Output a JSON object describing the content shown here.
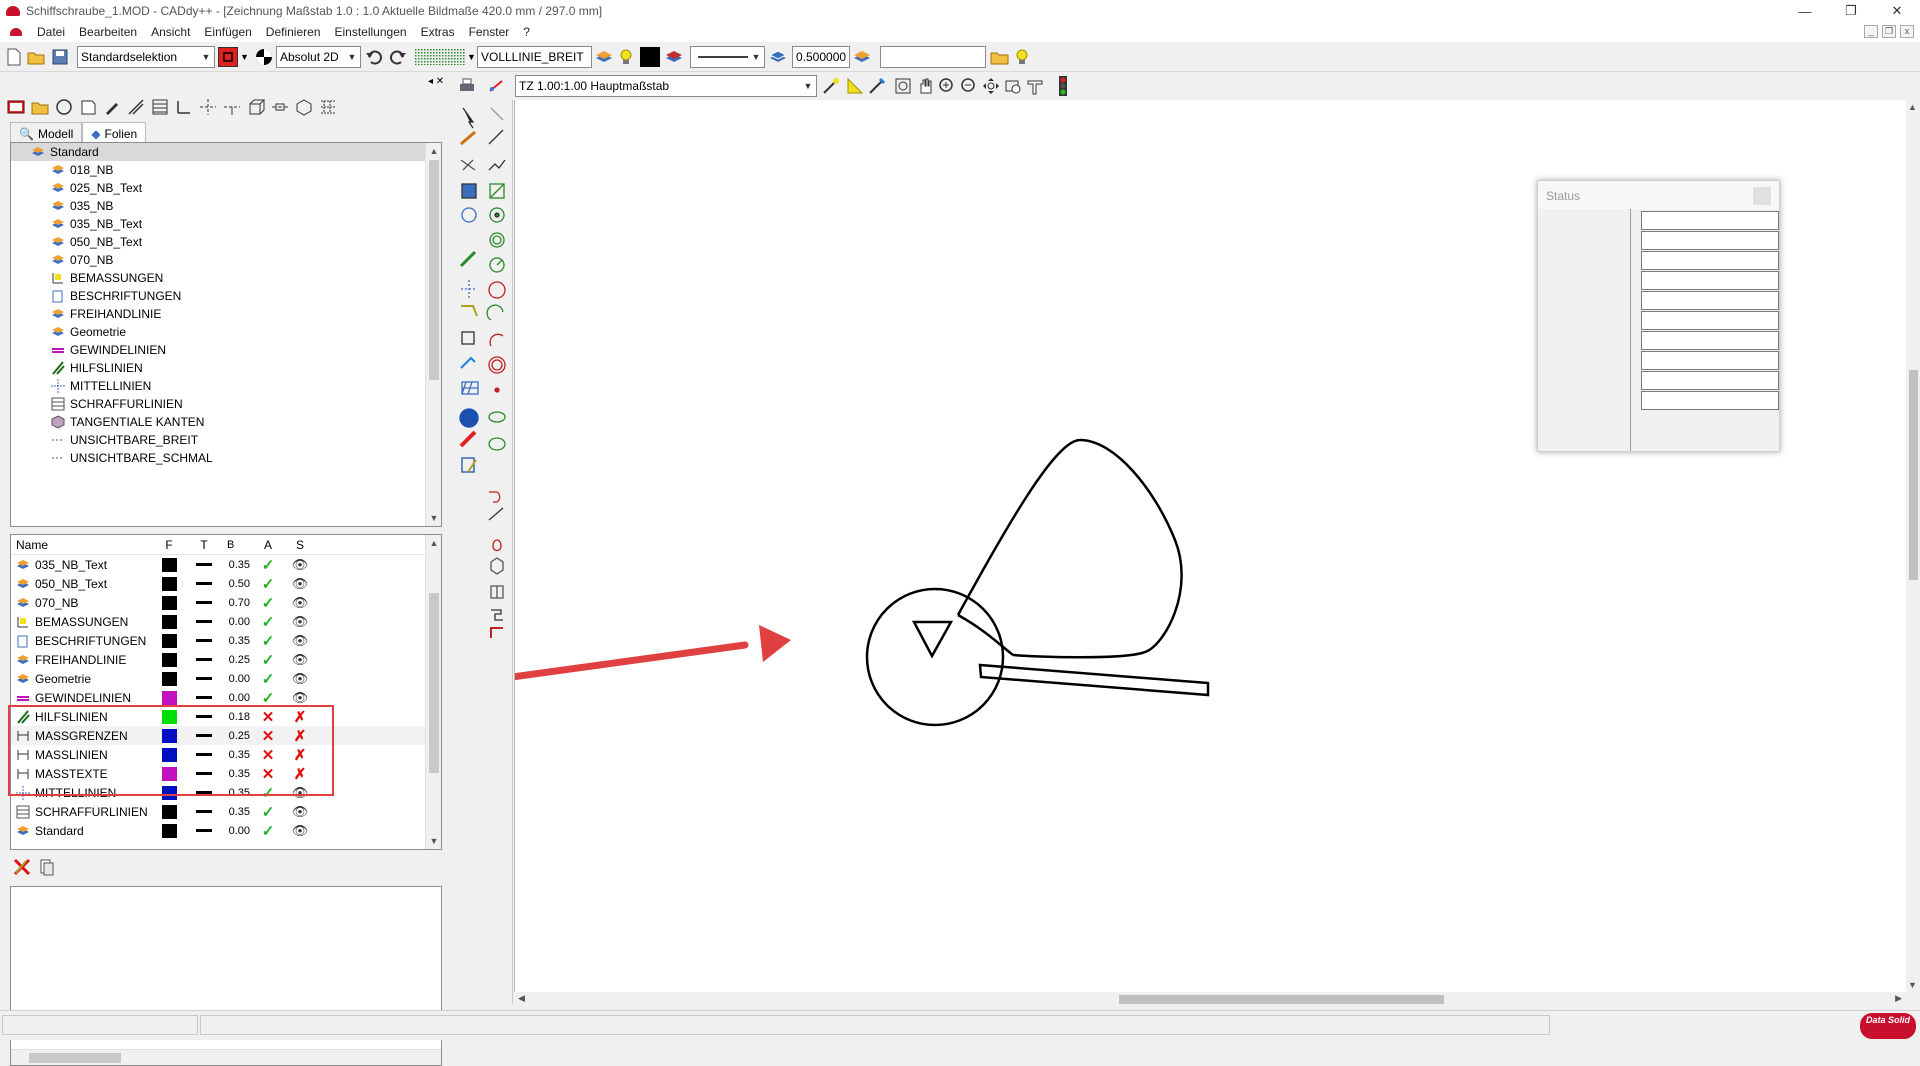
{
  "window": {
    "title": "Schiffschraube_1.MOD   -   CADdy++ - [Zeichnung    Maßstab 1.0 : 1.0    Aktuelle Bildmaße 420.0 mm / 297.0 mm]",
    "controls": [
      "—",
      "❐",
      "✕"
    ]
  },
  "menu": {
    "items": [
      "Datei",
      "Bearbeiten",
      "Ansicht",
      "Einfügen",
      "Definieren",
      "Einstellungen",
      "Extras",
      "Fenster",
      "?"
    ]
  },
  "toolbar": {
    "selection_mode": "Standardselektion",
    "coord_mode": "Absolut 2D",
    "line_type": "VOLLLINIE_BREIT",
    "line_width": "0.500000",
    "search_value": ""
  },
  "toolbar2": {
    "scale": "TZ 1.00:1.00 Hauptmaßstab"
  },
  "panel": {
    "tabs": [
      "Modell",
      "Folien"
    ],
    "active_tab": "Folien",
    "tree": [
      {
        "label": "Standard",
        "indent": 0,
        "icon": "layer-stack-icon",
        "selected": true
      },
      {
        "label": "018_NB",
        "indent": 1,
        "icon": "layer-stack-icon"
      },
      {
        "label": "025_NB_Text",
        "indent": 1,
        "icon": "layer-stack-icon"
      },
      {
        "label": "035_NB",
        "indent": 1,
        "icon": "layer-stack-icon"
      },
      {
        "label": "035_NB_Text",
        "indent": 1,
        "icon": "layer-stack-icon"
      },
      {
        "label": "050_NB_Text",
        "indent": 1,
        "icon": "layer-stack-icon"
      },
      {
        "label": "070_NB",
        "indent": 1,
        "icon": "layer-stack-icon"
      },
      {
        "label": "BEMASSUNGEN",
        "indent": 1,
        "icon": "dimension-icon"
      },
      {
        "label": "BESCHRIFTUNGEN",
        "indent": 1,
        "icon": "label-icon"
      },
      {
        "label": "FREIHANDLINIE",
        "indent": 1,
        "icon": "layer-stack-icon"
      },
      {
        "label": "Geometrie",
        "indent": 1,
        "icon": "layer-stack-icon"
      },
      {
        "label": "GEWINDELINIEN",
        "indent": 1,
        "icon": "thread-icon"
      },
      {
        "label": "HILFSLINIEN",
        "indent": 1,
        "icon": "helpline-icon"
      },
      {
        "label": "MITTELLINIEN",
        "indent": 1,
        "icon": "centerline-icon"
      },
      {
        "label": "SCHRAFFURLINIEN",
        "indent": 1,
        "icon": "hatch-icon"
      },
      {
        "label": "TANGENTIALE KANTEN",
        "indent": 1,
        "icon": "tangent-edge-icon"
      },
      {
        "label": "UNSICHTBARE_BREIT",
        "indent": 1,
        "icon": "hidden-line-icon"
      },
      {
        "label": "UNSICHTBARE_SCHMAL",
        "indent": 1,
        "icon": "hidden-line-icon"
      }
    ],
    "list_columns": [
      "Name",
      "F",
      "T",
      "B",
      "A",
      "S"
    ],
    "list_rows": [
      {
        "name": "035_NB_Text",
        "color": "#000000",
        "width": "0.35",
        "active": true,
        "visible": true
      },
      {
        "name": "050_NB_Text",
        "color": "#000000",
        "width": "0.50",
        "active": true,
        "visible": true
      },
      {
        "name": "070_NB",
        "color": "#000000",
        "width": "0.70",
        "active": true,
        "visible": true
      },
      {
        "name": "BEMASSUNGEN",
        "color": "#000000",
        "width": "0.00",
        "active": true,
        "visible": true
      },
      {
        "name": "BESCHRIFTUNGEN",
        "color": "#000000",
        "width": "0.35",
        "active": true,
        "visible": true
      },
      {
        "name": "FREIHANDLINIE",
        "color": "#000000",
        "width": "0.25",
        "active": true,
        "visible": true
      },
      {
        "name": "Geometrie",
        "color": "#000000",
        "width": "0.00",
        "active": true,
        "visible": true
      },
      {
        "name": "GEWINDELINIEN",
        "color": "#c010c0",
        "width": "0.00",
        "active": true,
        "visible": true
      },
      {
        "name": "HILFSLINIEN",
        "color": "#00e000",
        "width": "0.18",
        "active": false,
        "visible": false
      },
      {
        "name": "MASSGRENZEN",
        "color": "#0010c0",
        "width": "0.25",
        "active": false,
        "visible": false
      },
      {
        "name": "MASSLINIEN",
        "color": "#0010c0",
        "width": "0.35",
        "active": false,
        "visible": false
      },
      {
        "name": "MASSTEXTE",
        "color": "#c010c0",
        "width": "0.35",
        "active": false,
        "visible": false
      },
      {
        "name": "MITTELLINIEN",
        "color": "#0010c0",
        "width": "0.35",
        "active": true,
        "visible": true
      },
      {
        "name": "SCHRAFFURLINIEN",
        "color": "#000000",
        "width": "0.35",
        "active": true,
        "visible": true
      },
      {
        "name": "Standard",
        "color": "#000000",
        "width": "0.00",
        "active": true,
        "visible": true
      }
    ]
  },
  "status_window": {
    "title": "Status",
    "field_count": 10
  },
  "brand": {
    "logo_text": "Data Solid"
  },
  "colors": {
    "accent_red": "#e04040",
    "grid_green": "#22b022"
  }
}
